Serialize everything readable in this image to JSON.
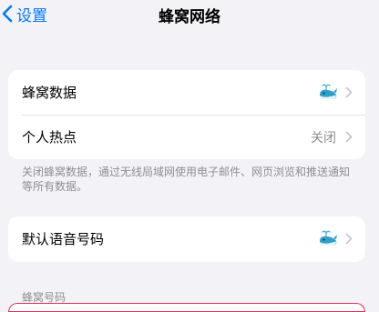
{
  "nav": {
    "back_label": "设置",
    "title": "蜂窝网络"
  },
  "sections": {
    "main": {
      "rows": [
        {
          "label": "蜂窝数据",
          "icon": "whale-icon"
        },
        {
          "label": "个人热点",
          "value": "关闭"
        }
      ],
      "footer": "关闭蜂窝数据，通过无线局域网使用电子邮件、网页浏览和推送通知等所有数据。"
    },
    "voice": {
      "rows": [
        {
          "label": "默认语音号码",
          "icon": "whale-icon"
        }
      ]
    },
    "numbers": {
      "header": "蜂窝号码"
    }
  },
  "colors": {
    "accent": "#007aff",
    "background": "#f2f2f7",
    "secondary_text": "#8e8e93",
    "whale": "#2f9fc9",
    "bottom_border": "#d9345a"
  }
}
